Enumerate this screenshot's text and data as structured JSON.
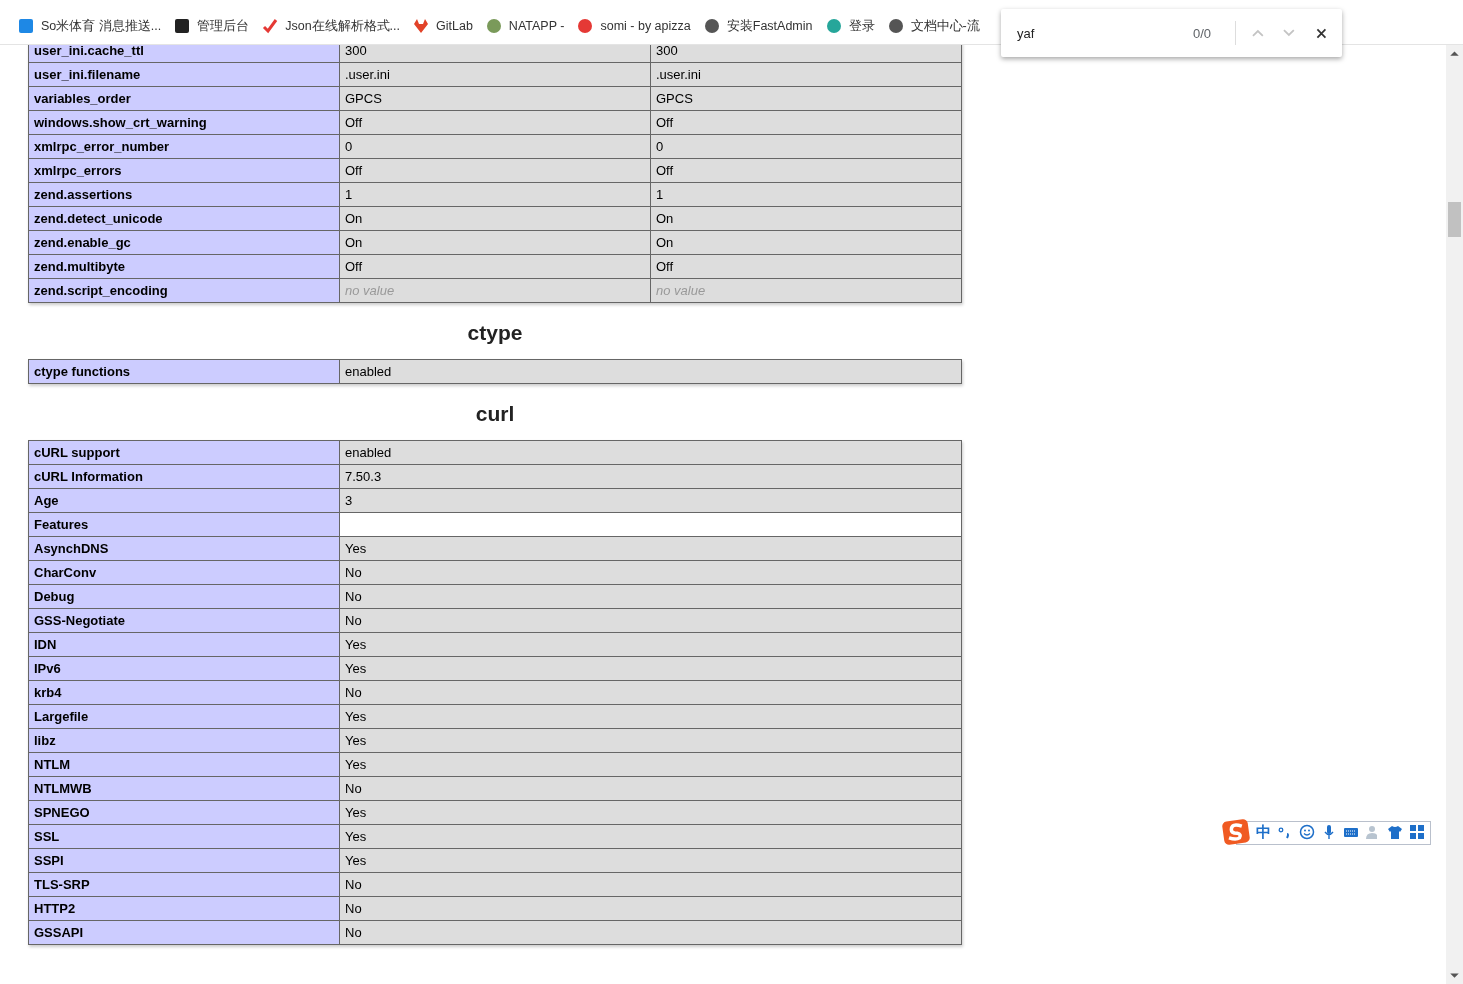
{
  "bookmarks": [
    {
      "label": "So米体育 消息推送..."
    },
    {
      "label": "管理后台"
    },
    {
      "label": "Json在线解析格式..."
    },
    {
      "label": "GitLab"
    },
    {
      "label": "NATAPP -"
    },
    {
      "label": "somi - by apizza"
    },
    {
      "label": "安装FastAdmin"
    },
    {
      "label": "登录"
    },
    {
      "label": "文档中心-流"
    }
  ],
  "find_bar": {
    "value": "yaf",
    "count": "0/0",
    "nav_disabled": true
  },
  "sections": [
    {
      "rows": [
        {
          "name": "user_ini.cache_ttl",
          "values": [
            "300",
            "300"
          ]
        },
        {
          "name": "user_ini.filename",
          "values": [
            ".user.ini",
            ".user.ini"
          ]
        },
        {
          "name": "variables_order",
          "values": [
            "GPCS",
            "GPCS"
          ]
        },
        {
          "name": "windows.show_crt_warning",
          "values": [
            "Off",
            "Off"
          ]
        },
        {
          "name": "xmlrpc_error_number",
          "values": [
            "0",
            "0"
          ]
        },
        {
          "name": "xmlrpc_errors",
          "values": [
            "Off",
            "Off"
          ]
        },
        {
          "name": "zend.assertions",
          "values": [
            "1",
            "1"
          ]
        },
        {
          "name": "zend.detect_unicode",
          "values": [
            "On",
            "On"
          ]
        },
        {
          "name": "zend.enable_gc",
          "values": [
            "On",
            "On"
          ]
        },
        {
          "name": "zend.multibyte",
          "values": [
            "Off",
            "Off"
          ]
        },
        {
          "name": "zend.script_encoding",
          "values": [
            "no value",
            "no value"
          ],
          "kind": "novalue"
        }
      ]
    },
    {
      "title": "ctype",
      "rows": [
        {
          "name": "ctype functions",
          "values": [
            "enabled"
          ]
        }
      ]
    },
    {
      "title": "curl",
      "rows": [
        {
          "name": "cURL support",
          "values": [
            "enabled"
          ]
        },
        {
          "name": "cURL Information",
          "values": [
            "7.50.3"
          ]
        },
        {
          "name": "Age",
          "values": [
            "3"
          ]
        },
        {
          "name": "Features",
          "kind": "subheader"
        },
        {
          "name": "AsynchDNS",
          "values": [
            "Yes"
          ]
        },
        {
          "name": "CharConv",
          "values": [
            "No"
          ]
        },
        {
          "name": "Debug",
          "values": [
            "No"
          ]
        },
        {
          "name": "GSS-Negotiate",
          "values": [
            "No"
          ]
        },
        {
          "name": "IDN",
          "values": [
            "Yes"
          ]
        },
        {
          "name": "IPv6",
          "values": [
            "Yes"
          ]
        },
        {
          "name": "krb4",
          "values": [
            "No"
          ]
        },
        {
          "name": "Largefile",
          "values": [
            "Yes"
          ]
        },
        {
          "name": "libz",
          "values": [
            "Yes"
          ]
        },
        {
          "name": "NTLM",
          "values": [
            "Yes"
          ]
        },
        {
          "name": "NTLMWB",
          "values": [
            "No"
          ]
        },
        {
          "name": "SPNEGO",
          "values": [
            "Yes"
          ]
        },
        {
          "name": "SSL",
          "values": [
            "Yes"
          ]
        },
        {
          "name": "SSPI",
          "values": [
            "Yes"
          ]
        },
        {
          "name": "TLS-SRP",
          "values": [
            "No"
          ]
        },
        {
          "name": "HTTP2",
          "values": [
            "No"
          ]
        },
        {
          "name": "GSSAPI",
          "values": [
            "No"
          ]
        }
      ]
    }
  ],
  "ime_toolbar": {
    "mode": "中"
  }
}
